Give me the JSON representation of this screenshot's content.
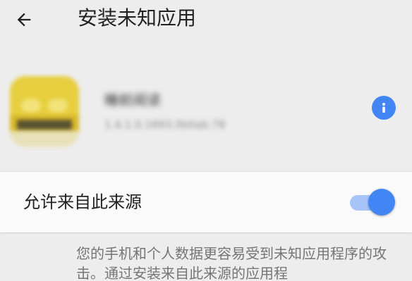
{
  "toolbar": {
    "title": "安装未知应用",
    "back_icon": "arrow-left-icon"
  },
  "app": {
    "name": "睡前阅读",
    "version": "1.4.1.0.1893.0b0ab.78",
    "info_icon": "info-icon"
  },
  "setting": {
    "label": "允许来自此来源",
    "enabled": true
  },
  "warning": {
    "text": "您的手机和个人数据更容易受到未知应用程序的攻击。通过安装来自此来源的应用程"
  },
  "colors": {
    "accent": "#4285f4",
    "accent_track": "#a6c4f8",
    "background": "#ededed",
    "card": "#fafafa"
  }
}
